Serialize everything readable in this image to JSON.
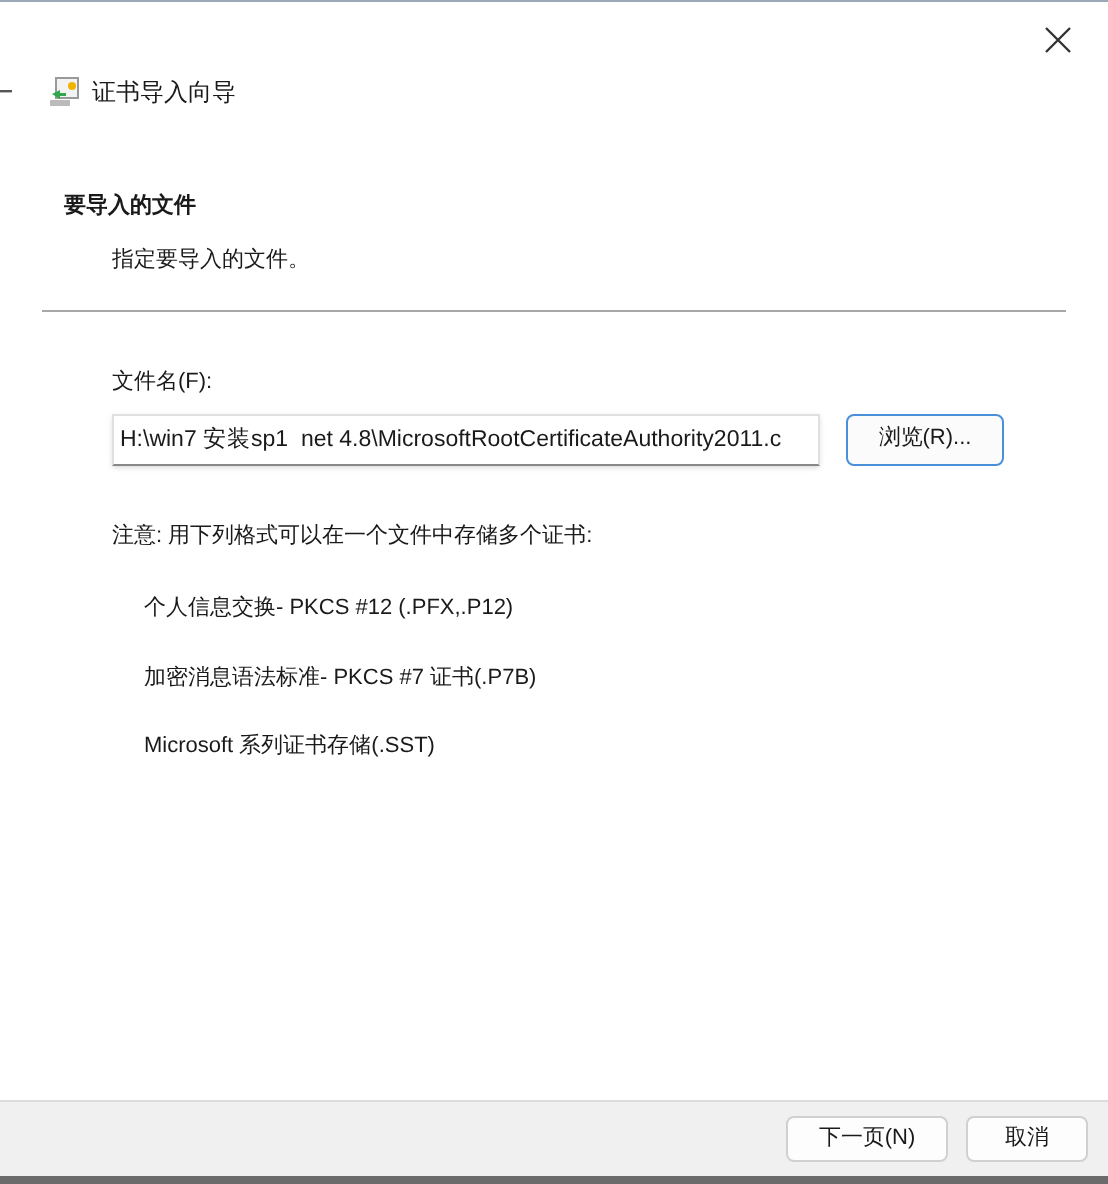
{
  "window": {
    "title": "证书导入向导"
  },
  "header": {
    "title": "要导入的文件",
    "subtitle": "指定要导入的文件。"
  },
  "file_field": {
    "label": "文件名(F):",
    "value": "H:\\win7 安装sp1  net 4.8\\MicrosoftRootCertificateAuthority2011.c",
    "browse_button": "浏览(R)..."
  },
  "note": "注意: 用下列格式可以在一个文件中存储多个证书:",
  "formats": [
    "个人信息交换- PKCS #12 (.PFX,.P12)",
    "加密消息语法标准- PKCS #7 证书(.P7B)",
    "Microsoft 系列证书存储(.SST)"
  ],
  "buttons": [
    {
      "label": "下一页(N)",
      "kind": "next"
    },
    {
      "label": "取消",
      "kind": "cancel"
    }
  ]
}
